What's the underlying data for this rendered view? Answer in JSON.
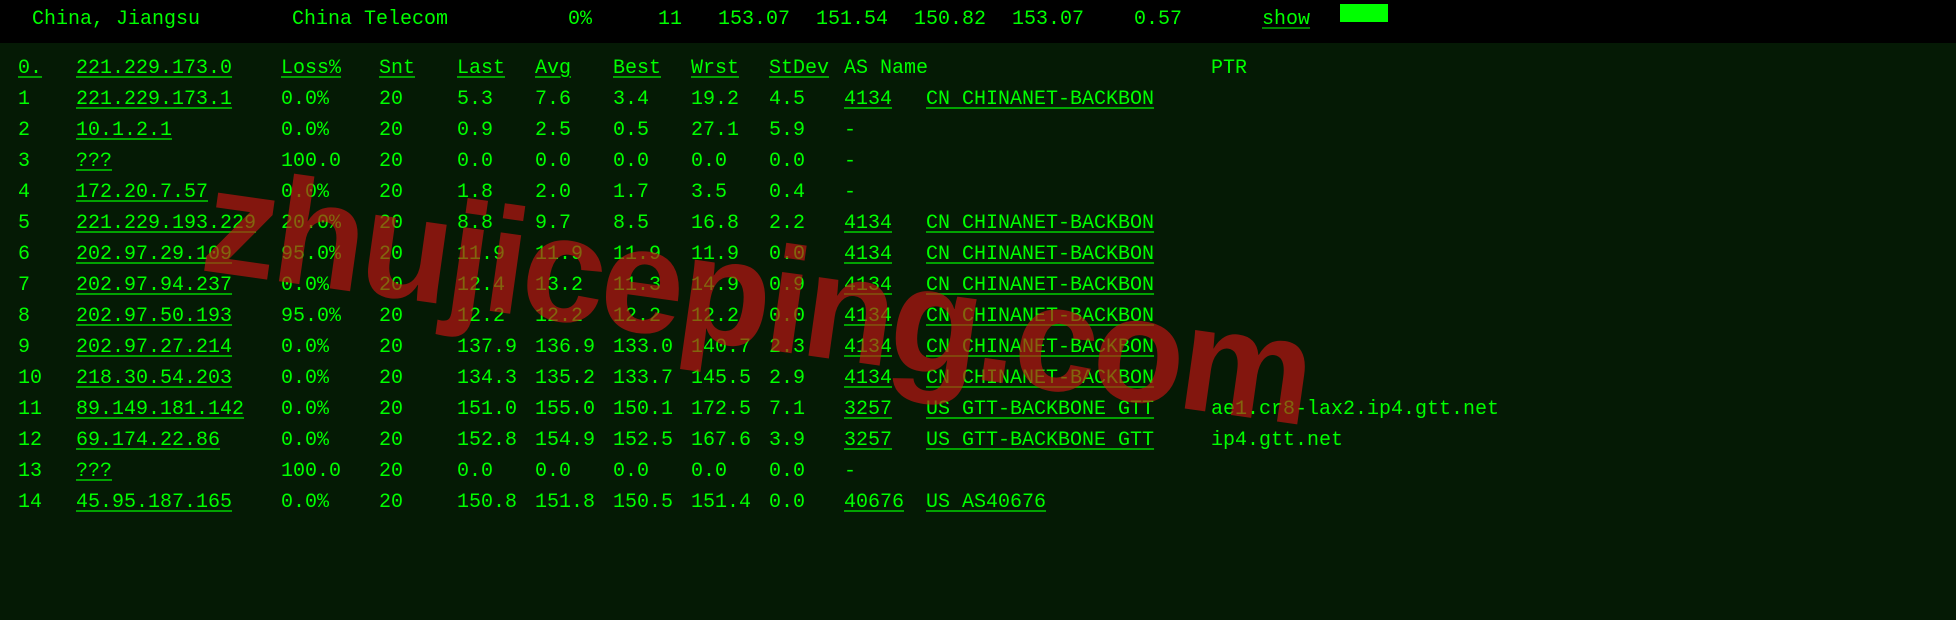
{
  "summary": {
    "location": "China, Jiangsu",
    "isp": "China Telecom",
    "loss": "0%",
    "count": "11",
    "last": "153.07",
    "avg": "151.54",
    "best": "150.82",
    "wrst": "153.07",
    "stdev": "0.57",
    "show_label": "show"
  },
  "headers": {
    "idx": "0.",
    "ip": "221.229.173.0",
    "loss": "Loss%",
    "snt": "Snt",
    "last": "Last",
    "avg": "Avg",
    "best": "Best",
    "wrst": "Wrst",
    "stdev": "StDev",
    "as": "AS Name",
    "ptr": "PTR"
  },
  "hops": [
    {
      "idx": "1",
      "ip": "221.229.173.1",
      "loss": "0.0%",
      "snt": "20",
      "last": "5.3",
      "avg": "7.6",
      "best": "3.4",
      "wrst": "19.2",
      "stdev": "4.5",
      "as": "4134",
      "name": "CN CHINANET-BACKBON",
      "ptr": ""
    },
    {
      "idx": "2",
      "ip": "10.1.2.1",
      "loss": "0.0%",
      "snt": "20",
      "last": "0.9",
      "avg": "2.5",
      "best": "0.5",
      "wrst": "27.1",
      "stdev": "5.9",
      "as": "-",
      "name": "",
      "ptr": ""
    },
    {
      "idx": "3",
      "ip": "???",
      "loss": "100.0",
      "snt": "20",
      "last": "0.0",
      "avg": "0.0",
      "best": "0.0",
      "wrst": "0.0",
      "stdev": "0.0",
      "as": "-",
      "name": "",
      "ptr": ""
    },
    {
      "idx": "4",
      "ip": "172.20.7.57",
      "loss": "0.0%",
      "snt": "20",
      "last": "1.8",
      "avg": "2.0",
      "best": "1.7",
      "wrst": "3.5",
      "stdev": "0.4",
      "as": "-",
      "name": "",
      "ptr": ""
    },
    {
      "idx": "5",
      "ip": "221.229.193.229",
      "loss": "20.0%",
      "snt": "20",
      "last": "8.8",
      "avg": "9.7",
      "best": "8.5",
      "wrst": "16.8",
      "stdev": "2.2",
      "as": "4134",
      "name": "CN CHINANET-BACKBON",
      "ptr": ""
    },
    {
      "idx": "6",
      "ip": "202.97.29.109",
      "loss": "95.0%",
      "snt": "20",
      "last": "11.9",
      "avg": "11.9",
      "best": "11.9",
      "wrst": "11.9",
      "stdev": "0.0",
      "as": "4134",
      "name": "CN CHINANET-BACKBON",
      "ptr": ""
    },
    {
      "idx": "7",
      "ip": "202.97.94.237",
      "loss": "0.0%",
      "snt": "20",
      "last": "12.4",
      "avg": "13.2",
      "best": "11.3",
      "wrst": "14.9",
      "stdev": "0.9",
      "as": "4134",
      "name": "CN CHINANET-BACKBON",
      "ptr": ""
    },
    {
      "idx": "8",
      "ip": "202.97.50.193",
      "loss": "95.0%",
      "snt": "20",
      "last": "12.2",
      "avg": "12.2",
      "best": "12.2",
      "wrst": "12.2",
      "stdev": "0.0",
      "as": "4134",
      "name": "CN CHINANET-BACKBON",
      "ptr": ""
    },
    {
      "idx": "9",
      "ip": "202.97.27.214",
      "loss": "0.0%",
      "snt": "20",
      "last": "137.9",
      "avg": "136.9",
      "best": "133.0",
      "wrst": "140.7",
      "stdev": "2.3",
      "as": "4134",
      "name": "CN CHINANET-BACKBON",
      "ptr": ""
    },
    {
      "idx": "10",
      "ip": "218.30.54.203",
      "loss": "0.0%",
      "snt": "20",
      "last": "134.3",
      "avg": "135.2",
      "best": "133.7",
      "wrst": "145.5",
      "stdev": "2.9",
      "as": "4134",
      "name": "CN CHINANET-BACKBON",
      "ptr": ""
    },
    {
      "idx": "11",
      "ip": "89.149.181.142",
      "loss": "0.0%",
      "snt": "20",
      "last": "151.0",
      "avg": "155.0",
      "best": "150.1",
      "wrst": "172.5",
      "stdev": "7.1",
      "as": "3257",
      "name": "US GTT-BACKBONE GTT",
      "ptr": "ae1.cr8-lax2.ip4.gtt.net"
    },
    {
      "idx": "12",
      "ip": "69.174.22.86",
      "loss": "0.0%",
      "snt": "20",
      "last": "152.8",
      "avg": "154.9",
      "best": "152.5",
      "wrst": "167.6",
      "stdev": "3.9",
      "as": "3257",
      "name": "US GTT-BACKBONE GTT",
      "ptr": "ip4.gtt.net"
    },
    {
      "idx": "13",
      "ip": "???",
      "loss": "100.0",
      "snt": "20",
      "last": "0.0",
      "avg": "0.0",
      "best": "0.0",
      "wrst": "0.0",
      "stdev": "0.0",
      "as": "-",
      "name": "",
      "ptr": ""
    },
    {
      "idx": "14",
      "ip": "45.95.187.165",
      "loss": "0.0%",
      "snt": "20",
      "last": "150.8",
      "avg": "151.8",
      "best": "150.5",
      "wrst": "151.4",
      "stdev": "0.0",
      "as": "40676",
      "name": "US AS40676",
      "ptr": ""
    }
  ],
  "watermark": "zhujiceping.com"
}
